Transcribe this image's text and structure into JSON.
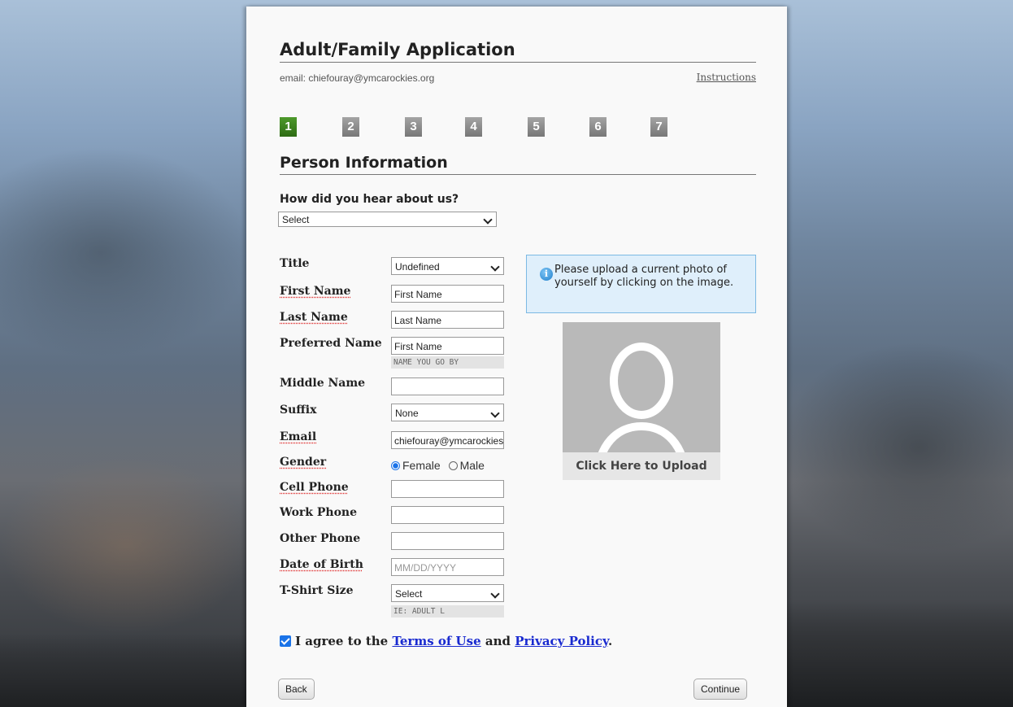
{
  "header": {
    "title": "Adult/Family Application",
    "email": "email: chiefouray@ymcarockies.org",
    "instructions": "Instructions"
  },
  "steps": [
    "1",
    "2",
    "3",
    "4",
    "5",
    "6",
    "7"
  ],
  "active_step": "1",
  "section": {
    "title": "Person Information",
    "hear_label": "How did you hear about us?",
    "hear_value": "Select"
  },
  "fields": {
    "title": {
      "label": "Title",
      "value": "Undefined"
    },
    "first_name": {
      "label": "First Name",
      "value": "First Name"
    },
    "last_name": {
      "label": "Last Name",
      "value": "Last Name"
    },
    "preferred_name": {
      "label": "Preferred Name",
      "value": "First Name",
      "hint": "NAME YOU GO BY"
    },
    "middle_name": {
      "label": "Middle Name",
      "value": ""
    },
    "suffix": {
      "label": "Suffix",
      "value": "None"
    },
    "email": {
      "label": "Email",
      "value": "chiefouray@ymcarockies.org"
    },
    "gender": {
      "label": "Gender",
      "female": "Female",
      "male": "Male",
      "selected": "Female"
    },
    "cell_phone": {
      "label": "Cell Phone",
      "value": ""
    },
    "work_phone": {
      "label": "Work Phone",
      "value": ""
    },
    "other_phone": {
      "label": "Other Phone",
      "value": ""
    },
    "dob": {
      "label": "Date of Birth",
      "placeholder": "MM/DD/YYYY"
    },
    "tshirt": {
      "label": "T-Shirt Size",
      "value": "Select",
      "hint": "IE: ADULT L"
    }
  },
  "photo": {
    "info": "Please upload a current photo of yourself by clicking on the image.",
    "upload_label": "Click Here to Upload"
  },
  "agree": {
    "prefix": "I agree to the",
    "terms": "Terms of Use",
    "and": "and",
    "privacy": "Privacy Policy",
    "suffix": ".",
    "checked": true
  },
  "buttons": {
    "back": "Back",
    "continue": "Continue"
  },
  "colors": {
    "active_step": "#3a8a1e",
    "inactive_step": "#8a8a8a",
    "link": "#1a2bd0",
    "info_bg": "#dfeffb"
  }
}
